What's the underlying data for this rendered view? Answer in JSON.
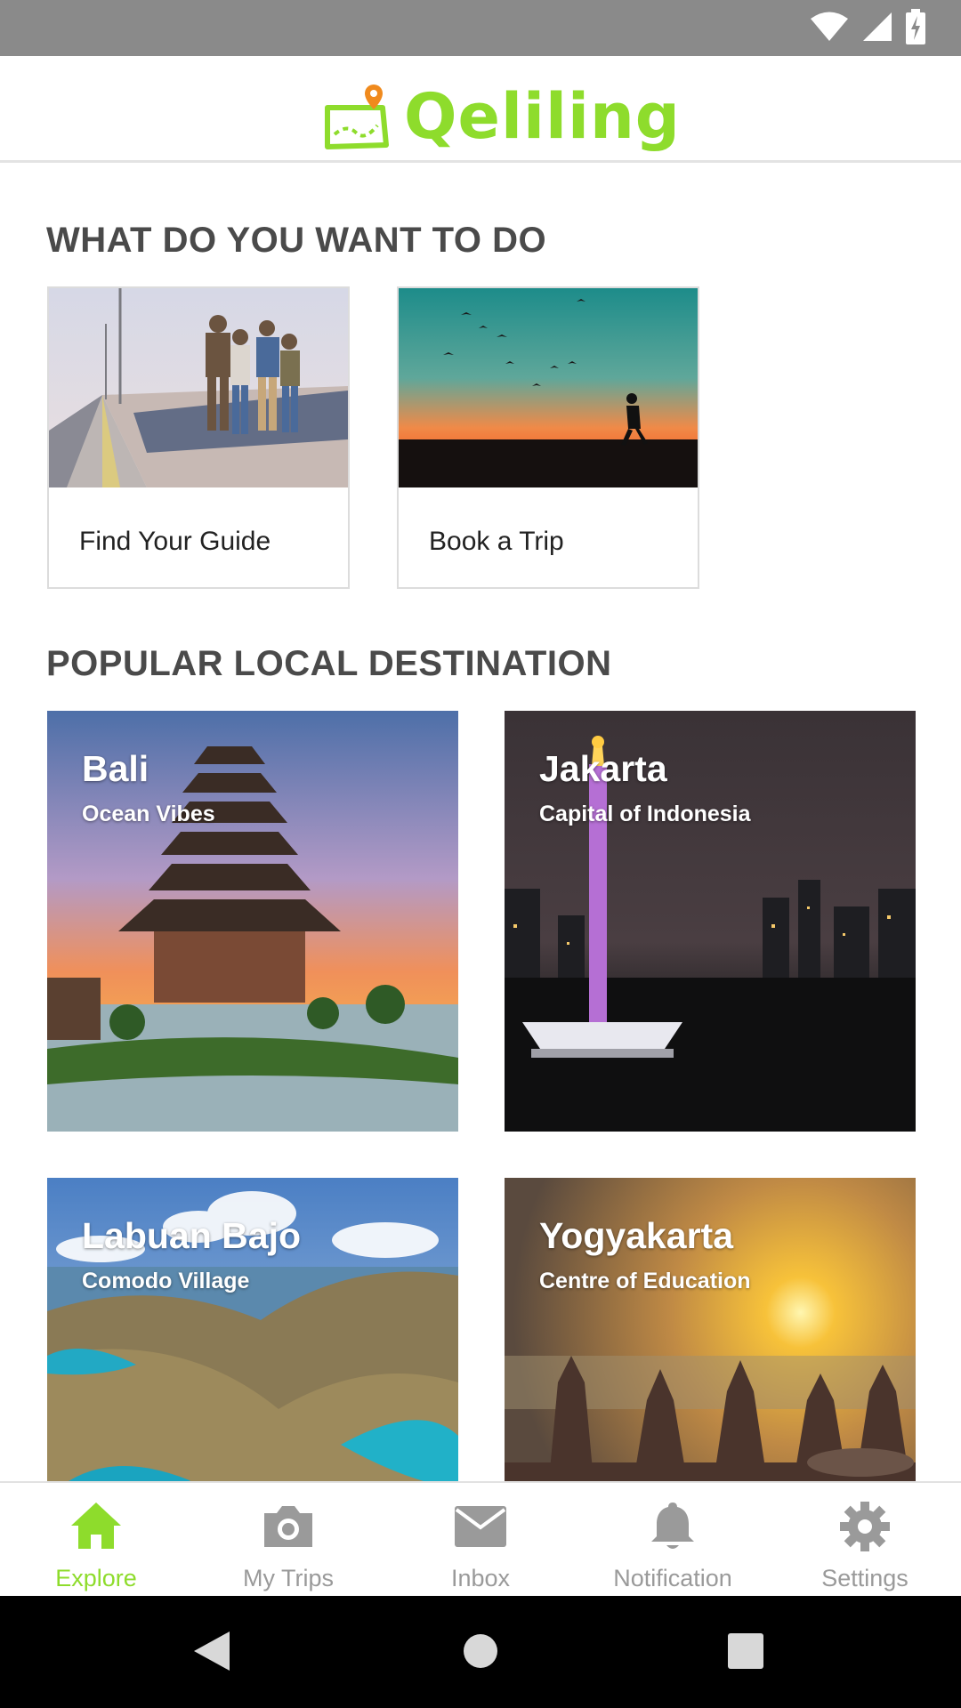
{
  "app": {
    "name": "Qeliling",
    "brand_color": "#8edc2c",
    "pin_color": "#f08a1d"
  },
  "sections": {
    "what_to_do": "WHAT DO YOU WANT TO DO",
    "popular": "POPULAR LOCAL DESTINATION"
  },
  "actions": [
    {
      "label": "Find Your Guide",
      "image": "friends-on-bridge-photo"
    },
    {
      "label": "Book a Trip",
      "image": "sunset-hiker-photo"
    }
  ],
  "destinations": [
    {
      "title": "Bali",
      "subtitle": "Ocean Vibes",
      "image": "temple-sunset-photo"
    },
    {
      "title": "Jakarta",
      "subtitle": "Capital of Indonesia",
      "image": "monument-night-photo"
    },
    {
      "title": "Labuan Bajo",
      "subtitle": "Comodo Village",
      "image": "island-hills-photo"
    },
    {
      "title": "Yogyakarta",
      "subtitle": "Centre of Education",
      "image": "temple-dawn-photo"
    }
  ],
  "nav": {
    "items": [
      {
        "label": "Explore",
        "icon": "home-icon",
        "active": true
      },
      {
        "label": "My Trips",
        "icon": "camera-icon",
        "active": false
      },
      {
        "label": "Inbox",
        "icon": "mail-icon",
        "active": false
      },
      {
        "label": "Notification",
        "icon": "bell-icon",
        "active": false
      },
      {
        "label": "Settings",
        "icon": "gear-icon",
        "active": false
      }
    ],
    "active_color": "#8edc2c",
    "inactive_color": "#9a9a9a"
  }
}
